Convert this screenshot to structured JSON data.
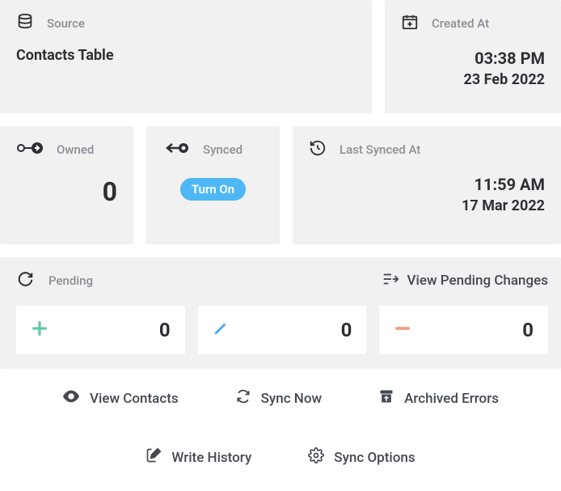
{
  "source": {
    "label": "Source",
    "value": "Contacts Table"
  },
  "created": {
    "label": "Created At",
    "time": "03:38 PM",
    "date": "23 Feb 2022"
  },
  "owned": {
    "label": "Owned",
    "value": "0"
  },
  "synced": {
    "label": "Synced",
    "button": "Turn On"
  },
  "last_synced": {
    "label": "Last Synced At",
    "time": "11:59 AM",
    "date": "17 Mar 2022"
  },
  "pending": {
    "label": "Pending",
    "view_link": "View Pending Changes",
    "added": "0",
    "edited": "0",
    "removed": "0"
  },
  "actions": {
    "view_contacts": "View Contacts",
    "sync_now": "Sync Now",
    "archived_errors": "Archived Errors",
    "write_history": "Write History",
    "sync_options": "Sync Options"
  }
}
